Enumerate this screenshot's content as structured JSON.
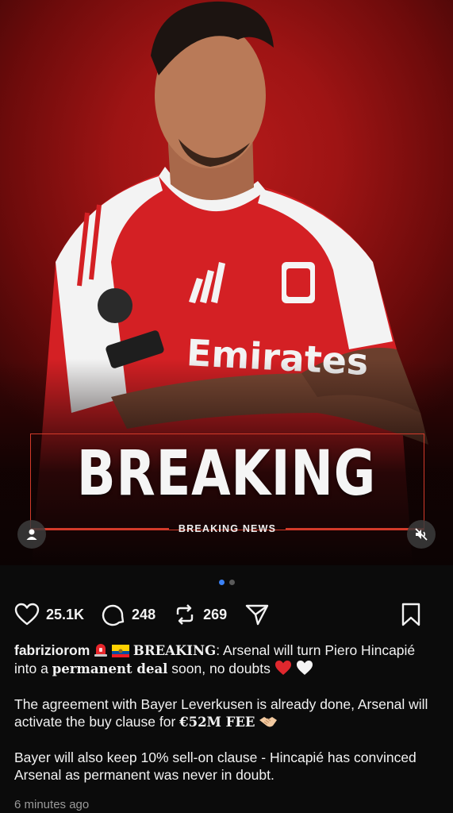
{
  "media": {
    "overlay_title": "BREAKING",
    "overlay_subtitle": "BREAKING NEWS",
    "jersey_sponsor": "Emirates",
    "club_badge": "Arsenal",
    "accent_color": "#d23a2a",
    "carousel": {
      "total": 2,
      "current": 1
    }
  },
  "actions": {
    "likes": "25.1K",
    "comments": "248",
    "reposts": "269",
    "icons": [
      "heart-icon",
      "comment-icon",
      "repost-icon",
      "share-icon",
      "bookmark-icon"
    ]
  },
  "caption": {
    "username": "fabriziorom",
    "p1_emphasis": "BREAKING",
    "p1_text_a": ": Arsenal will turn Piero Hincapié into a ",
    "p1_bold": "permanent deal",
    "p1_text_b": " soon, no doubts ",
    "p2_text": "The agreement with Bayer Leverkusen is already done, Arsenal will activate the buy clause for ",
    "p2_bold": "€52M FEE",
    "p3_text": "Bayer will also keep 10% sell-on clause - Hincapié has convinced Arsenal as permanent was never in doubt."
  },
  "timestamp": "6 minutes ago"
}
